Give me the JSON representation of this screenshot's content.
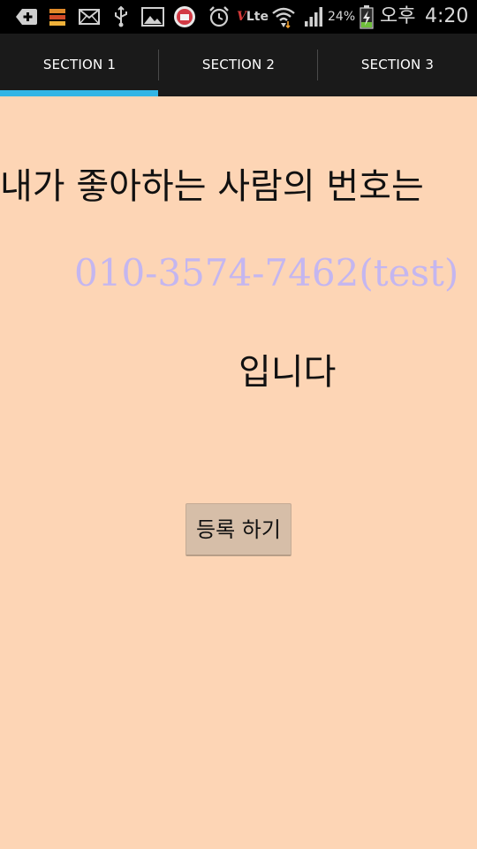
{
  "status_bar": {
    "icons": [
      "add-icon",
      "app-stack-icon",
      "mail-icon",
      "usb-icon",
      "gallery-icon",
      "app-badge-icon",
      "alarm-icon",
      "volte-icon",
      "wifi-icon",
      "signal-icon",
      "battery-charging-icon"
    ],
    "volte_label": "Lte",
    "battery_percent": "24%",
    "ampm": "오후",
    "time": "4:20"
  },
  "tabs": [
    {
      "label": "SECTION 1",
      "selected": true
    },
    {
      "label": "SECTION 2",
      "selected": false
    },
    {
      "label": "SECTION 3",
      "selected": false
    }
  ],
  "content": {
    "headline": "내가 좋아하는 사람의 번호는",
    "phone": "010-3574-7462(test)",
    "suffix": "입니다",
    "register_button": "등록 하기"
  },
  "colors": {
    "background": "#fdd5b5",
    "tab_indicator": "#33b5e5",
    "phone_text": "#c4b6f0",
    "button": "#d6bea8"
  }
}
